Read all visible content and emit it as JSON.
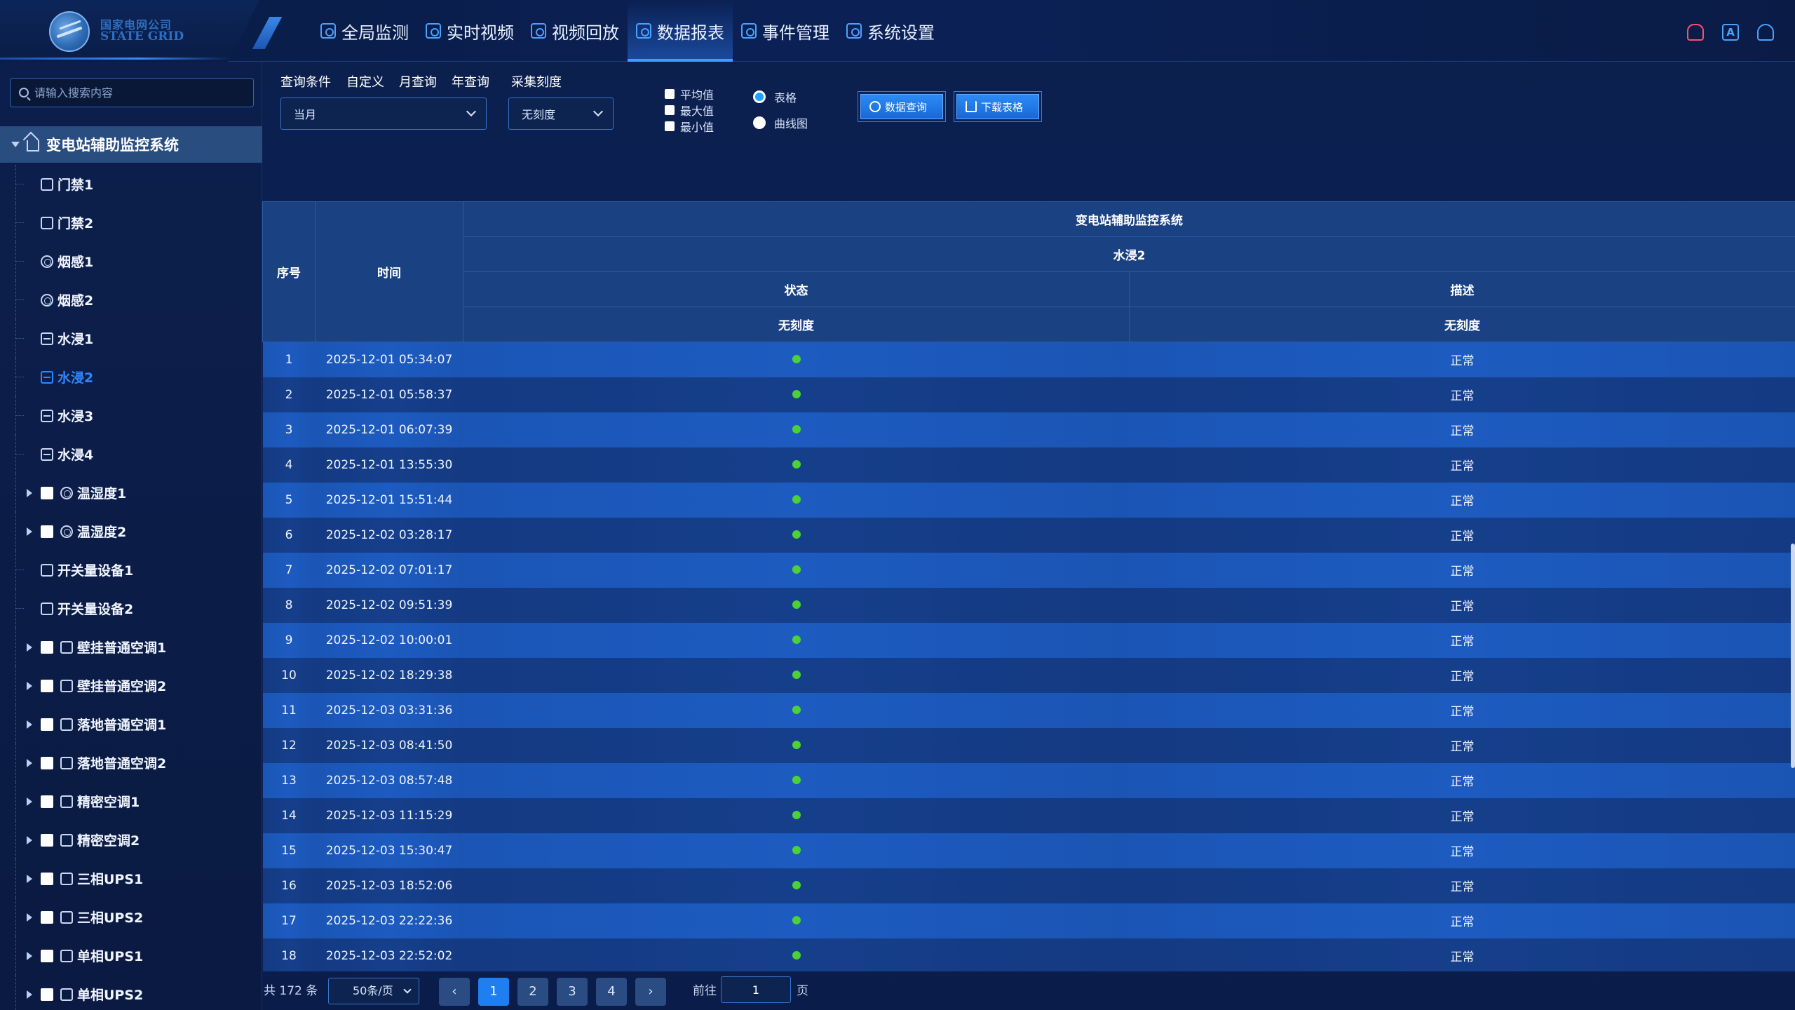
{
  "header": {
    "logo_cn": "国家电网公司",
    "logo_en": "STATE GRID",
    "nav": [
      {
        "label": "全局监测",
        "icon": "monitor-icon"
      },
      {
        "label": "实时视频",
        "icon": "video-icon"
      },
      {
        "label": "视频回放",
        "icon": "replay-icon"
      },
      {
        "label": "数据报表",
        "icon": "report-icon"
      },
      {
        "label": "事件管理",
        "icon": "event-icon"
      },
      {
        "label": "系统设置",
        "icon": "settings-icon"
      }
    ],
    "active_nav": "数据报表",
    "right_icons": [
      "alarm-icon",
      "font-icon",
      "user-icon"
    ],
    "font_icon_text": "A"
  },
  "sidebar": {
    "search_placeholder": "请输入搜索内容",
    "root": "变电站辅助监控系统",
    "items": [
      {
        "label": "门禁1",
        "kind": "leaf",
        "icon": "door-icon"
      },
      {
        "label": "门禁2",
        "kind": "leaf",
        "icon": "door-icon"
      },
      {
        "label": "烟感1",
        "kind": "leaf",
        "icon": "smoke-icon"
      },
      {
        "label": "烟感2",
        "kind": "leaf",
        "icon": "smoke-icon"
      },
      {
        "label": "水浸1",
        "kind": "leaf",
        "icon": "water-icon"
      },
      {
        "label": "水浸2",
        "kind": "leaf",
        "icon": "water-icon",
        "selected": true
      },
      {
        "label": "水浸3",
        "kind": "leaf",
        "icon": "water-icon"
      },
      {
        "label": "水浸4",
        "kind": "leaf",
        "icon": "water-icon"
      },
      {
        "label": "温湿度1",
        "kind": "branch",
        "icon": "thermometer-icon"
      },
      {
        "label": "温湿度2",
        "kind": "branch",
        "icon": "thermometer-icon"
      },
      {
        "label": "开关量设备1",
        "kind": "leaf",
        "icon": "switch-icon"
      },
      {
        "label": "开关量设备2",
        "kind": "leaf",
        "icon": "switch-icon"
      },
      {
        "label": "壁挂普通空调1",
        "kind": "branch",
        "icon": "ac-icon"
      },
      {
        "label": "壁挂普通空调2",
        "kind": "branch",
        "icon": "ac-icon"
      },
      {
        "label": "落地普通空调1",
        "kind": "branch",
        "icon": "ac-icon"
      },
      {
        "label": "落地普通空调2",
        "kind": "branch",
        "icon": "ac-icon"
      },
      {
        "label": "精密空调1",
        "kind": "branch",
        "icon": "precision-ac-icon"
      },
      {
        "label": "精密空调2",
        "kind": "branch",
        "icon": "precision-ac-icon"
      },
      {
        "label": "三相UPS1",
        "kind": "branch",
        "icon": "ups-icon"
      },
      {
        "label": "三相UPS2",
        "kind": "branch",
        "icon": "ups-icon"
      },
      {
        "label": "单相UPS1",
        "kind": "branch",
        "icon": "ups-icon"
      },
      {
        "label": "单相UPS2",
        "kind": "branch",
        "icon": "ups-icon"
      }
    ]
  },
  "filters": {
    "query_condition": "查询条件",
    "custom": "自定义",
    "month_query": "月查询",
    "year_query": "年查询",
    "sampling_scale": "采集刻度",
    "period_value": "当月",
    "scale_value": "无刻度",
    "checkboxes": [
      "平均值",
      "最大值",
      "最小值"
    ],
    "radio_table": "表格",
    "radio_curve": "曲线图",
    "query_button": "数据查询",
    "download_button": "下载表格"
  },
  "table": {
    "col_index": "序号",
    "col_time": "时间",
    "group_system": "变电站辅助监控系统",
    "group_device": "水浸2",
    "col_status": "状态",
    "col_desc": "描述",
    "sub_status": "无刻度",
    "sub_desc": "无刻度",
    "rows": [
      {
        "index": "1",
        "time": "2025-12-01 05:34:07",
        "desc": "正常"
      },
      {
        "index": "2",
        "time": "2025-12-01 05:58:37",
        "desc": "正常"
      },
      {
        "index": "3",
        "time": "2025-12-01 06:07:39",
        "desc": "正常"
      },
      {
        "index": "4",
        "time": "2025-12-01 13:55:30",
        "desc": "正常"
      },
      {
        "index": "5",
        "time": "2025-12-01 15:51:44",
        "desc": "正常"
      },
      {
        "index": "6",
        "time": "2025-12-02 03:28:17",
        "desc": "正常"
      },
      {
        "index": "7",
        "time": "2025-12-02 07:01:17",
        "desc": "正常"
      },
      {
        "index": "8",
        "time": "2025-12-02 09:51:39",
        "desc": "正常"
      },
      {
        "index": "9",
        "time": "2025-12-02 10:00:01",
        "desc": "正常"
      },
      {
        "index": "10",
        "time": "2025-12-02 18:29:38",
        "desc": "正常"
      },
      {
        "index": "11",
        "time": "2025-12-03 03:31:36",
        "desc": "正常"
      },
      {
        "index": "12",
        "time": "2025-12-03 08:41:50",
        "desc": "正常"
      },
      {
        "index": "13",
        "time": "2025-12-03 08:57:48",
        "desc": "正常"
      },
      {
        "index": "14",
        "time": "2025-12-03 11:15:29",
        "desc": "正常"
      },
      {
        "index": "15",
        "time": "2025-12-03 15:30:47",
        "desc": "正常"
      },
      {
        "index": "16",
        "time": "2025-12-03 18:52:06",
        "desc": "正常"
      },
      {
        "index": "17",
        "time": "2025-12-03 22:22:36",
        "desc": "正常"
      },
      {
        "index": "18",
        "time": "2025-12-03 22:52:02",
        "desc": "正常"
      }
    ],
    "status_color": "#4cd137"
  },
  "pagination": {
    "total": "共 172 条",
    "page_size": "50条/页",
    "pages": [
      "1",
      "2",
      "3",
      "4"
    ],
    "current": "1",
    "goto_prefix": "前往",
    "goto_value": "1",
    "goto_suffix": "页"
  },
  "colors": {
    "accent": "#1f7ef0",
    "background": "#0b2257",
    "selected_text": "#2f86ff",
    "alarm": "#ff4d6d"
  }
}
